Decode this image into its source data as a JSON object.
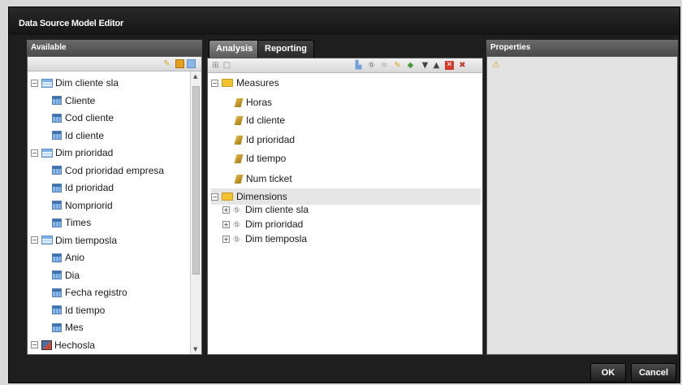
{
  "window": {
    "title": "Data Source Model Editor"
  },
  "available": {
    "header": "Available",
    "tree": [
      {
        "label": "Dim cliente sla",
        "type": "table",
        "expanded": true
      },
      {
        "label": "Cliente",
        "type": "column"
      },
      {
        "label": "Cod cliente",
        "type": "column"
      },
      {
        "label": "Id cliente",
        "type": "column"
      },
      {
        "label": "Dim prioridad",
        "type": "table",
        "expanded": true
      },
      {
        "label": "Cod prioridad empresa",
        "type": "column"
      },
      {
        "label": "Id prioridad",
        "type": "column"
      },
      {
        "label": "Nompriorid",
        "type": "column"
      },
      {
        "label": "Times",
        "type": "column"
      },
      {
        "label": "Dim tiemposla",
        "type": "table",
        "expanded": true
      },
      {
        "label": "Anio",
        "type": "column"
      },
      {
        "label": "Dia",
        "type": "column"
      },
      {
        "label": "Fecha registro",
        "type": "column"
      },
      {
        "label": "Id tiempo",
        "type": "column"
      },
      {
        "label": "Mes",
        "type": "column"
      },
      {
        "label": "Hechosla",
        "type": "fact",
        "expanded": true
      }
    ]
  },
  "tabs": [
    {
      "label": "Analysis",
      "active": true
    },
    {
      "label": "Reporting",
      "active": false
    }
  ],
  "analysis": {
    "tree": [
      {
        "label": "Measures",
        "type": "folder",
        "expanded": true
      },
      {
        "label": "Horas",
        "type": "measure"
      },
      {
        "label": "Id cliente",
        "type": "measure"
      },
      {
        "label": "Id prioridad",
        "type": "measure"
      },
      {
        "label": "Id tiempo",
        "type": "measure"
      },
      {
        "label": "Num ticket",
        "type": "measure"
      },
      {
        "label": "Dimensions",
        "type": "folder",
        "expanded": true
      },
      {
        "label": "Dim cliente sla",
        "type": "dimension"
      },
      {
        "label": "Dim prioridad",
        "type": "dimension"
      },
      {
        "label": "Dim tiemposla",
        "type": "dimension"
      }
    ]
  },
  "properties": {
    "header": "Properties",
    "warning_icon": "warning-icon"
  },
  "buttons": {
    "ok": "OK",
    "cancel": "Cancel"
  },
  "icons": [
    "pencil-icon",
    "table-icon",
    "column-icon",
    "folder-icon",
    "measure-icon",
    "hierarchy-icon",
    "warning-icon"
  ]
}
